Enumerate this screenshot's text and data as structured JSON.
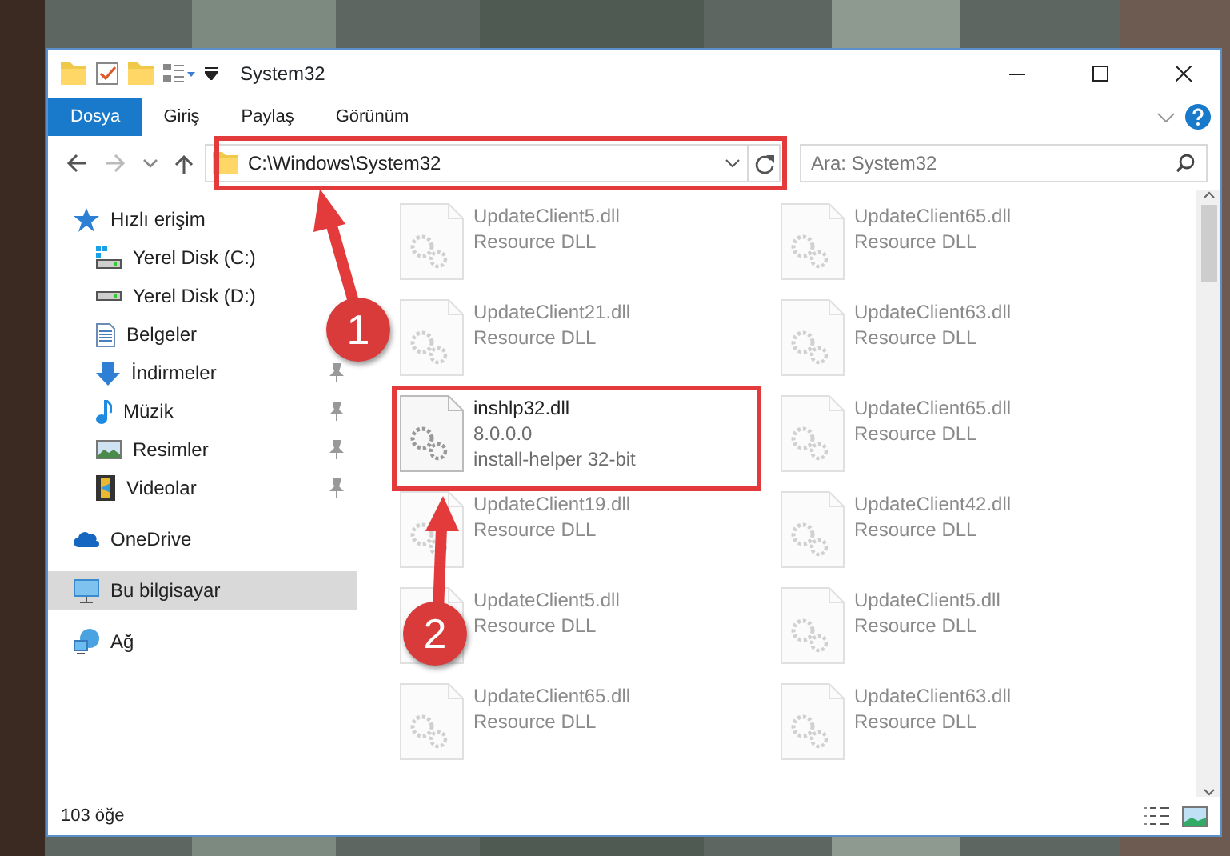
{
  "window": {
    "title": "System32"
  },
  "ribbon_tabs": [
    {
      "label": "Dosya",
      "kind": "file"
    },
    {
      "label": "Giriş",
      "kind": "tab"
    },
    {
      "label": "Paylaş",
      "kind": "tab"
    },
    {
      "label": "Görünüm",
      "kind": "tab"
    }
  ],
  "address": {
    "path": "C:\\Windows\\System32"
  },
  "search": {
    "placeholder": "Ara: System32"
  },
  "sidebar": {
    "items": [
      {
        "label": "Hızlı erişim",
        "kind": "star",
        "selected": false,
        "children": [
          {
            "label": "Yerel Disk (C:)",
            "kind": "drive-c",
            "pinned": false,
            "selected": false
          },
          {
            "label": "Yerel Disk (D:)",
            "kind": "drive",
            "pinned": false,
            "selected": false
          },
          {
            "label": "Belgeler",
            "kind": "documents",
            "pinned": false,
            "selected": false
          },
          {
            "label": "İndirmeler",
            "kind": "downloads",
            "pinned": true,
            "selected": false
          },
          {
            "label": "Müzik",
            "kind": "music",
            "pinned": true,
            "selected": false
          },
          {
            "label": "Resimler",
            "kind": "pictures",
            "pinned": true,
            "selected": false
          },
          {
            "label": "Videolar",
            "kind": "videos",
            "pinned": true,
            "selected": false
          }
        ]
      },
      {
        "label": "OneDrive",
        "kind": "cloud",
        "selected": false
      },
      {
        "label": "Bu bilgisayar",
        "kind": "computer",
        "selected": true
      },
      {
        "label": "Ağ",
        "kind": "network",
        "selected": false
      }
    ]
  },
  "files": [
    {
      "name": "UpdateClient5.dll",
      "description": "Resource DLL",
      "blurred": true
    },
    {
      "name": "UpdateClient65.dll",
      "description": "Resource DLL",
      "blurred": true
    },
    {
      "name": "UpdateClient21.dll",
      "description": "Resource DLL",
      "blurred": true
    },
    {
      "name": "UpdateClient63.dll",
      "description": "Resource DLL",
      "blurred": true
    },
    {
      "name": "inshlp32.dll",
      "version": "8.0.0.0",
      "description": "install-helper 32-bit",
      "blurred": false
    },
    {
      "name": "UpdateClient65.dll",
      "description": "Resource DLL",
      "blurred": true
    },
    {
      "name": "UpdateClient19.dll",
      "description": "Resource DLL",
      "blurred": true
    },
    {
      "name": "UpdateClient42.dll",
      "description": "Resource DLL",
      "blurred": true
    },
    {
      "name": "UpdateClient5.dll",
      "description": "Resource DLL",
      "blurred": true
    },
    {
      "name": "UpdateClient5.dll",
      "description": "Resource DLL",
      "blurred": true
    },
    {
      "name": "UpdateClient65.dll",
      "description": "Resource DLL",
      "blurred": true
    },
    {
      "name": "UpdateClient63.dll",
      "description": "Resource DLL",
      "blurred": true
    }
  ],
  "status_bar": {
    "count": "103 öğe"
  },
  "annotations": [
    {
      "label": "1"
    },
    {
      "label": "2"
    }
  ]
}
